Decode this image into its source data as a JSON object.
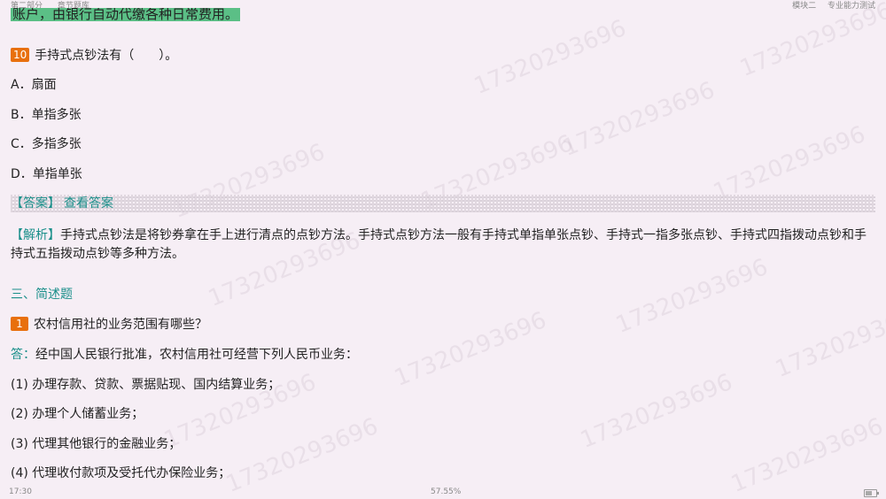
{
  "header": {
    "part": "第二部分",
    "section": "章节题库",
    "module": "模块二",
    "subject": "专业能力测试"
  },
  "top_highlight": "账户，由银行自动代缴各种日常费用。",
  "question10": {
    "number": "10",
    "stem": "手持式点钞法有（　　）。",
    "options": [
      "A．扇面",
      "B．单指多张",
      "C．多指多张",
      "D．单指单张"
    ]
  },
  "answer": {
    "label": "【答案】",
    "link": "查看答案"
  },
  "analysis": {
    "label": "【解析】",
    "text": "手持式点钞法是将钞券拿在手上进行清点的点钞方法。手持式点钞方法一般有手持式单指单张点钞、手持式一指多张点钞、手持式四指拨动点钞和手持式五指拨动点钞等多种方法。"
  },
  "section3": {
    "title": "三、简述题"
  },
  "question1": {
    "number": "1",
    "stem": "农村信用社的业务范围有哪些？",
    "answer_label": "答：",
    "answer_intro": "经中国人民银行批准，农村信用社可经营下列人民币业务：",
    "items": [
      "(1) 办理存款、贷款、票据贴现、国内结算业务；",
      "(2) 办理个人储蓄业务；",
      "(3) 代理其他银行的金融业务；",
      "(4) 代理收付款项及受托代办保险业务；"
    ]
  },
  "watermark": "17320293696",
  "footer": {
    "time": "17:30",
    "progress": "57.55%",
    "battery_level": 0.6
  }
}
